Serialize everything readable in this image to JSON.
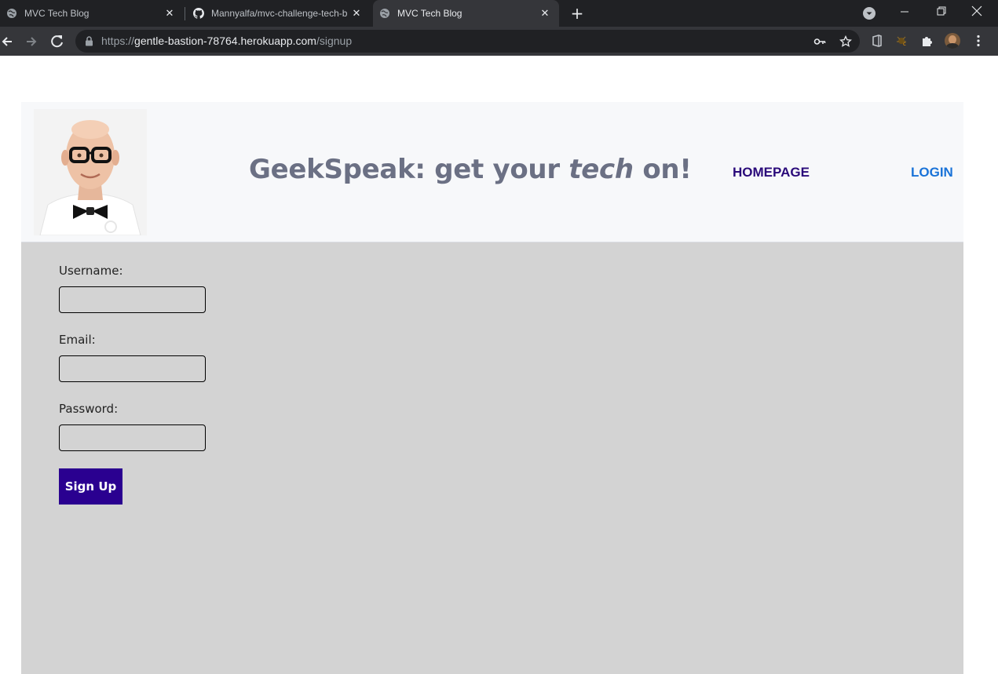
{
  "browser": {
    "tabs": [
      {
        "title": "MVC Tech Blog",
        "favicon": "globe-icon",
        "active": false
      },
      {
        "title": "Mannyalfa/mvc-challenge-tech-b",
        "favicon": "github-icon",
        "active": false
      },
      {
        "title": "MVC Tech Blog",
        "favicon": "globe-icon",
        "active": true
      }
    ],
    "url_scheme": "https://",
    "url_host": "gentle-bastion-78764.herokuapp.com",
    "url_path": "/signup"
  },
  "header": {
    "title_prefix": "GeekSpeak: get your ",
    "title_emphasis": "tech",
    "title_suffix": " on!",
    "nav": {
      "homepage": "HOMEPAGE",
      "login": "LOGIN"
    }
  },
  "form": {
    "username_label": "Username:",
    "username_value": "",
    "email_label": "Email:",
    "email_value": "",
    "password_label": "Password:",
    "password_value": "",
    "submit_label": "Sign Up"
  },
  "colors": {
    "chrome_dark": "#202124",
    "chrome_toolbar": "#35363a",
    "header_bg": "#f7f8fa",
    "form_bg": "#d3d3d3",
    "title_color": "#6b7084",
    "homepage_link": "#2a0a7a",
    "login_link": "#1a73d8",
    "button_bg": "#2a0090"
  }
}
